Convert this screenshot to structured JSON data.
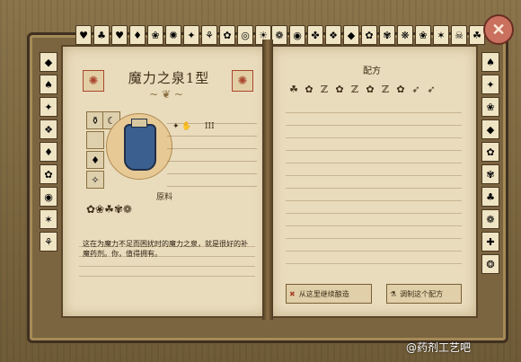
{
  "book": {
    "title": "魔力之泉1型",
    "ingredients_label": "原料",
    "description": "这在为魔力不足而困扰时的魔力之泉，就是很好的补魔药剂。你，值得拥有。",
    "recipe_header": "配方",
    "recipe_icons": [
      "☘",
      "✿",
      "ℤ",
      "✿",
      "ℤ",
      "✿",
      "ℤ",
      "✿",
      "➶",
      "➶"
    ],
    "tier_text": "III",
    "actions": [
      {
        "label": "从这里继续酿造",
        "icon": "✖"
      },
      {
        "label": "调制这个配方",
        "icon": "⚗"
      }
    ]
  },
  "top_tabs": [
    "♥",
    "♣",
    "♥",
    "♦",
    "❀",
    "✺",
    "✦",
    "⚘",
    "✿",
    "◎",
    "☀",
    "✥",
    "✱",
    "✣",
    "❁",
    "◉",
    "✤",
    "❖",
    "◆",
    "✿",
    "✾",
    "❋",
    "❀",
    "✶",
    "☠",
    "☘",
    "✦",
    "◈",
    "❂",
    "☼",
    "✻",
    "✲",
    "✷"
  ],
  "left_side_tabs": [
    "◆",
    "♠",
    "✦",
    "❖",
    "♦",
    "✿",
    "◉",
    "✶",
    "⚘"
  ],
  "right_side_tabs": [
    "♠",
    "✦",
    "❀",
    "◆",
    "✿",
    "✾",
    "♣",
    "❁",
    "✚",
    "❂"
  ],
  "close_icon": "✕",
  "watermark": "@药剂工艺吧"
}
